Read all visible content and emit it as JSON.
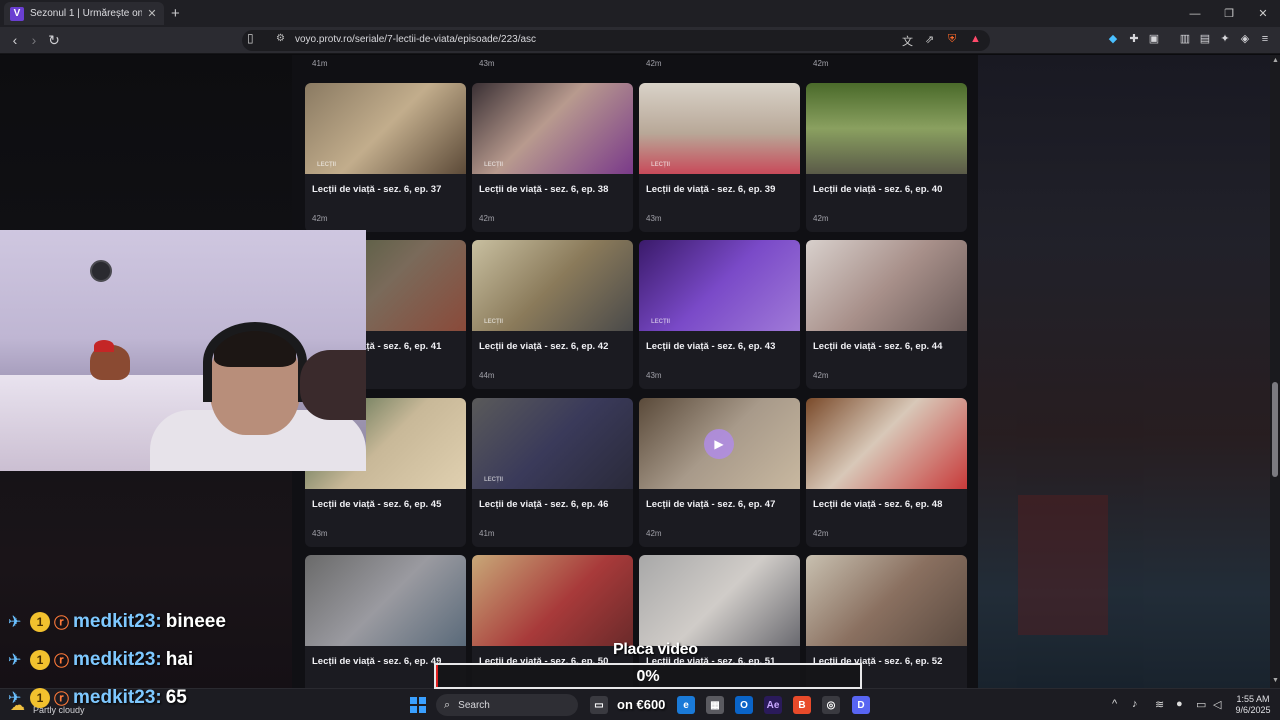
{
  "browser": {
    "tab_title": "Sezonul 1 | Urmărește online no",
    "tab_favicon": "V",
    "url": "voyo.protv.ro/seriale/7-lectii-de-viata/episoade/223/asc"
  },
  "top_row_durations": [
    "41m",
    "43m",
    "42m",
    "42m"
  ],
  "episodes": [
    {
      "title": "Lecții de viață - sez. 6, ep. 37",
      "duration": "42m"
    },
    {
      "title": "Lecții de viață - sez. 6, ep. 38",
      "duration": "42m"
    },
    {
      "title": "Lecții de viață - sez. 6, ep. 39",
      "duration": "43m"
    },
    {
      "title": "Lecții de viață - sez. 6, ep. 40",
      "duration": "42m"
    },
    {
      "title": "Lecții de viață - sez. 6, ep. 41",
      "duration": ""
    },
    {
      "title": "Lecții de viață - sez. 6, ep. 42",
      "duration": "44m"
    },
    {
      "title": "Lecții de viață - sez. 6, ep. 43",
      "duration": "43m"
    },
    {
      "title": "Lecții de viață - sez. 6, ep. 44",
      "duration": "42m"
    },
    {
      "title": "Lecții de viață - sez. 6, ep. 45",
      "duration": "43m"
    },
    {
      "title": "Lecții de viață - sez. 6, ep. 46",
      "duration": "41m"
    },
    {
      "title": "Lecții de viață - sez. 6, ep. 47",
      "duration": "42m"
    },
    {
      "title": "Lecții de viață - sez. 6, ep. 48",
      "duration": "42m"
    },
    {
      "title": "Lecții de viață - sez. 6, ep. 49",
      "duration": ""
    },
    {
      "title": "Lecții de viață - sez. 6, ep. 50",
      "duration": ""
    },
    {
      "title": "Lecții de viață - sez. 6, ep. 51",
      "duration": ""
    },
    {
      "title": "Lecții de viață - sez. 6, ep. 52",
      "duration": ""
    }
  ],
  "thumb_logo": "LECȚII",
  "chat": [
    {
      "badge": "1",
      "user": "medkit23:",
      "message": "bineee"
    },
    {
      "badge": "1",
      "user": "medkit23:",
      "message": "hai"
    },
    {
      "badge": "1",
      "user": "medkit23:",
      "message": "65"
    }
  ],
  "video_overlay": {
    "label": "Placa video",
    "percent_text": "0%",
    "progress": 0.0
  },
  "taskbar": {
    "weather": "Partly cloudy",
    "search_label": "Search",
    "promo_text": "on €600",
    "time": "1:55 AM",
    "date": "9/6/2025"
  },
  "colors": {
    "accent": "#6a3fd1",
    "chat_user": "#7ec8ff",
    "progress_fill": "#e02020"
  }
}
